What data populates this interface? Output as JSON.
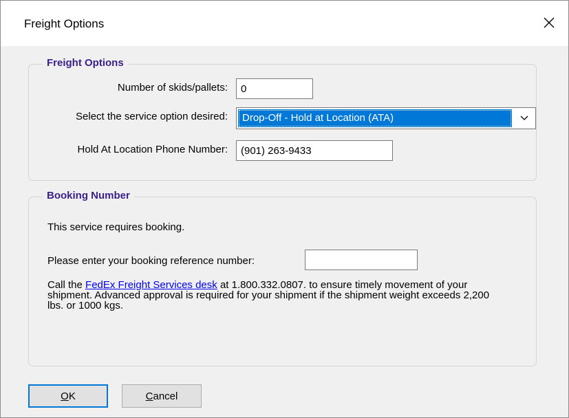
{
  "dialog": {
    "title": "Freight Options",
    "close_glyph": "×"
  },
  "freight_group": {
    "title": "Freight Options",
    "skids_label": "Number of skids/pallets:",
    "skids_value": "0",
    "service_label": "Select the service option desired:",
    "service_selected": "Drop-Off - Hold at Location (ATA)",
    "phone_label": "Hold At Location Phone Number:",
    "phone_value": "(901) 263-9433"
  },
  "booking_group": {
    "title": "Booking Number",
    "requires_text": "This service requires booking.",
    "reference_label": "Please enter your booking reference number:",
    "reference_value": "",
    "info_prefix": "Call the ",
    "info_link": "FedEx Freight Services desk",
    "info_suffix": " at 1.800.332.0807. to ensure timely movement of your shipment.  Advanced approval is required for your shipment if the shipment weight exceeds 2,200 lbs. or 1000 kgs."
  },
  "buttons": {
    "ok_label": "OK",
    "cancel_label": "Cancel"
  },
  "icons": {
    "close": "close-icon",
    "dropdown": "chevron-down-icon"
  },
  "colors": {
    "accent": "#0078d7",
    "group_title": "#3a1f8a",
    "link": "#0000ee"
  }
}
